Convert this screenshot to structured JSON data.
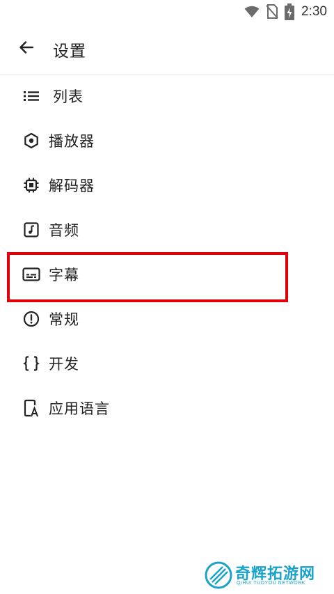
{
  "status_bar": {
    "time": "2:30",
    "icons": [
      "wifi-icon",
      "no-sim-icon",
      "battery-charging-icon"
    ]
  },
  "app_bar": {
    "back_icon": "arrow-left-icon",
    "title": "设置"
  },
  "menu": {
    "items": [
      {
        "label": "列表",
        "icon": "list-icon"
      },
      {
        "label": "播放器",
        "icon": "hexagon-icon"
      },
      {
        "label": "解码器",
        "icon": "chip-icon"
      },
      {
        "label": "音频",
        "icon": "music-note-icon"
      },
      {
        "label": "字幕",
        "icon": "subtitles-icon",
        "highlighted": true
      },
      {
        "label": "常规",
        "icon": "alert-circle-icon"
      },
      {
        "label": "开发",
        "icon": "code-braces-icon"
      },
      {
        "label": "应用语言",
        "icon": "language-icon"
      }
    ]
  },
  "highlight_color": "#e0000b",
  "watermark": {
    "title": "奇辉拓游网",
    "subtitle": "QIHUI TUOYOU NETWORK"
  }
}
